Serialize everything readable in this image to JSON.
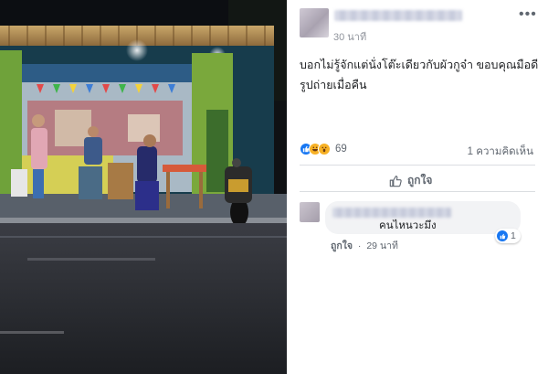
{
  "photo": {
    "alt": "night street scene with roadside eatery and parked motorcycle"
  },
  "post": {
    "timestamp": "30 นาที",
    "more_icon": "more-horizontal-icon",
    "text": "บอกไม่รู้จักแต่นั่งโต๊ะเดียวกับผัวกูจ๋า ขอบคุณมือดีรูปถ่ายเมื่อคืน",
    "reactions": {
      "icons": [
        "like-icon",
        "haha-icon",
        "wow-icon"
      ],
      "count": "69"
    },
    "comment_count": "1 ความคิดเห็น",
    "actions": {
      "like_label": "ถูกใจ"
    }
  },
  "comment": {
    "text": "คนไหนวะมึง",
    "like_link": "ถูกใจ",
    "separator": "·",
    "time": "29 นาที",
    "reaction_count": "1"
  },
  "colors": {
    "accent": "#1877f2",
    "secondary_text": "#606770",
    "bubble": "#f2f3f5"
  }
}
